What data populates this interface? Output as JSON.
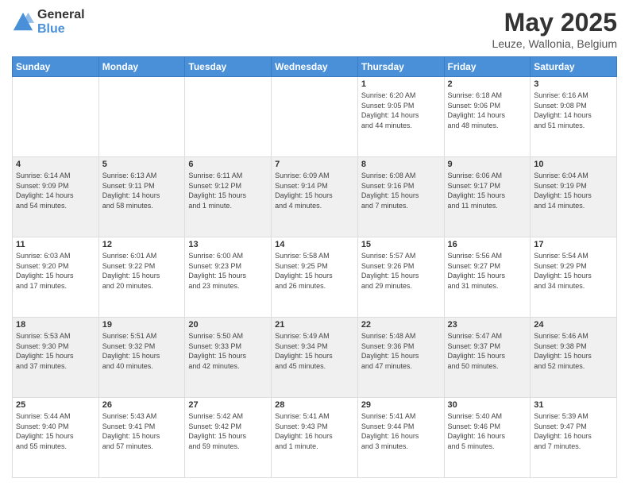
{
  "header": {
    "logo_general": "General",
    "logo_blue": "Blue",
    "title": "May 2025",
    "location": "Leuze, Wallonia, Belgium"
  },
  "days_of_week": [
    "Sunday",
    "Monday",
    "Tuesday",
    "Wednesday",
    "Thursday",
    "Friday",
    "Saturday"
  ],
  "weeks": [
    [
      {
        "num": "",
        "info": ""
      },
      {
        "num": "",
        "info": ""
      },
      {
        "num": "",
        "info": ""
      },
      {
        "num": "",
        "info": ""
      },
      {
        "num": "1",
        "info": "Sunrise: 6:20 AM\nSunset: 9:05 PM\nDaylight: 14 hours\nand 44 minutes."
      },
      {
        "num": "2",
        "info": "Sunrise: 6:18 AM\nSunset: 9:06 PM\nDaylight: 14 hours\nand 48 minutes."
      },
      {
        "num": "3",
        "info": "Sunrise: 6:16 AM\nSunset: 9:08 PM\nDaylight: 14 hours\nand 51 minutes."
      }
    ],
    [
      {
        "num": "4",
        "info": "Sunrise: 6:14 AM\nSunset: 9:09 PM\nDaylight: 14 hours\nand 54 minutes."
      },
      {
        "num": "5",
        "info": "Sunrise: 6:13 AM\nSunset: 9:11 PM\nDaylight: 14 hours\nand 58 minutes."
      },
      {
        "num": "6",
        "info": "Sunrise: 6:11 AM\nSunset: 9:12 PM\nDaylight: 15 hours\nand 1 minute."
      },
      {
        "num": "7",
        "info": "Sunrise: 6:09 AM\nSunset: 9:14 PM\nDaylight: 15 hours\nand 4 minutes."
      },
      {
        "num": "8",
        "info": "Sunrise: 6:08 AM\nSunset: 9:16 PM\nDaylight: 15 hours\nand 7 minutes."
      },
      {
        "num": "9",
        "info": "Sunrise: 6:06 AM\nSunset: 9:17 PM\nDaylight: 15 hours\nand 11 minutes."
      },
      {
        "num": "10",
        "info": "Sunrise: 6:04 AM\nSunset: 9:19 PM\nDaylight: 15 hours\nand 14 minutes."
      }
    ],
    [
      {
        "num": "11",
        "info": "Sunrise: 6:03 AM\nSunset: 9:20 PM\nDaylight: 15 hours\nand 17 minutes."
      },
      {
        "num": "12",
        "info": "Sunrise: 6:01 AM\nSunset: 9:22 PM\nDaylight: 15 hours\nand 20 minutes."
      },
      {
        "num": "13",
        "info": "Sunrise: 6:00 AM\nSunset: 9:23 PM\nDaylight: 15 hours\nand 23 minutes."
      },
      {
        "num": "14",
        "info": "Sunrise: 5:58 AM\nSunset: 9:25 PM\nDaylight: 15 hours\nand 26 minutes."
      },
      {
        "num": "15",
        "info": "Sunrise: 5:57 AM\nSunset: 9:26 PM\nDaylight: 15 hours\nand 29 minutes."
      },
      {
        "num": "16",
        "info": "Sunrise: 5:56 AM\nSunset: 9:27 PM\nDaylight: 15 hours\nand 31 minutes."
      },
      {
        "num": "17",
        "info": "Sunrise: 5:54 AM\nSunset: 9:29 PM\nDaylight: 15 hours\nand 34 minutes."
      }
    ],
    [
      {
        "num": "18",
        "info": "Sunrise: 5:53 AM\nSunset: 9:30 PM\nDaylight: 15 hours\nand 37 minutes."
      },
      {
        "num": "19",
        "info": "Sunrise: 5:51 AM\nSunset: 9:32 PM\nDaylight: 15 hours\nand 40 minutes."
      },
      {
        "num": "20",
        "info": "Sunrise: 5:50 AM\nSunset: 9:33 PM\nDaylight: 15 hours\nand 42 minutes."
      },
      {
        "num": "21",
        "info": "Sunrise: 5:49 AM\nSunset: 9:34 PM\nDaylight: 15 hours\nand 45 minutes."
      },
      {
        "num": "22",
        "info": "Sunrise: 5:48 AM\nSunset: 9:36 PM\nDaylight: 15 hours\nand 47 minutes."
      },
      {
        "num": "23",
        "info": "Sunrise: 5:47 AM\nSunset: 9:37 PM\nDaylight: 15 hours\nand 50 minutes."
      },
      {
        "num": "24",
        "info": "Sunrise: 5:46 AM\nSunset: 9:38 PM\nDaylight: 15 hours\nand 52 minutes."
      }
    ],
    [
      {
        "num": "25",
        "info": "Sunrise: 5:44 AM\nSunset: 9:40 PM\nDaylight: 15 hours\nand 55 minutes."
      },
      {
        "num": "26",
        "info": "Sunrise: 5:43 AM\nSunset: 9:41 PM\nDaylight: 15 hours\nand 57 minutes."
      },
      {
        "num": "27",
        "info": "Sunrise: 5:42 AM\nSunset: 9:42 PM\nDaylight: 15 hours\nand 59 minutes."
      },
      {
        "num": "28",
        "info": "Sunrise: 5:41 AM\nSunset: 9:43 PM\nDaylight: 16 hours\nand 1 minute."
      },
      {
        "num": "29",
        "info": "Sunrise: 5:41 AM\nSunset: 9:44 PM\nDaylight: 16 hours\nand 3 minutes."
      },
      {
        "num": "30",
        "info": "Sunrise: 5:40 AM\nSunset: 9:46 PM\nDaylight: 16 hours\nand 5 minutes."
      },
      {
        "num": "31",
        "info": "Sunrise: 5:39 AM\nSunset: 9:47 PM\nDaylight: 16 hours\nand 7 minutes."
      }
    ]
  ]
}
